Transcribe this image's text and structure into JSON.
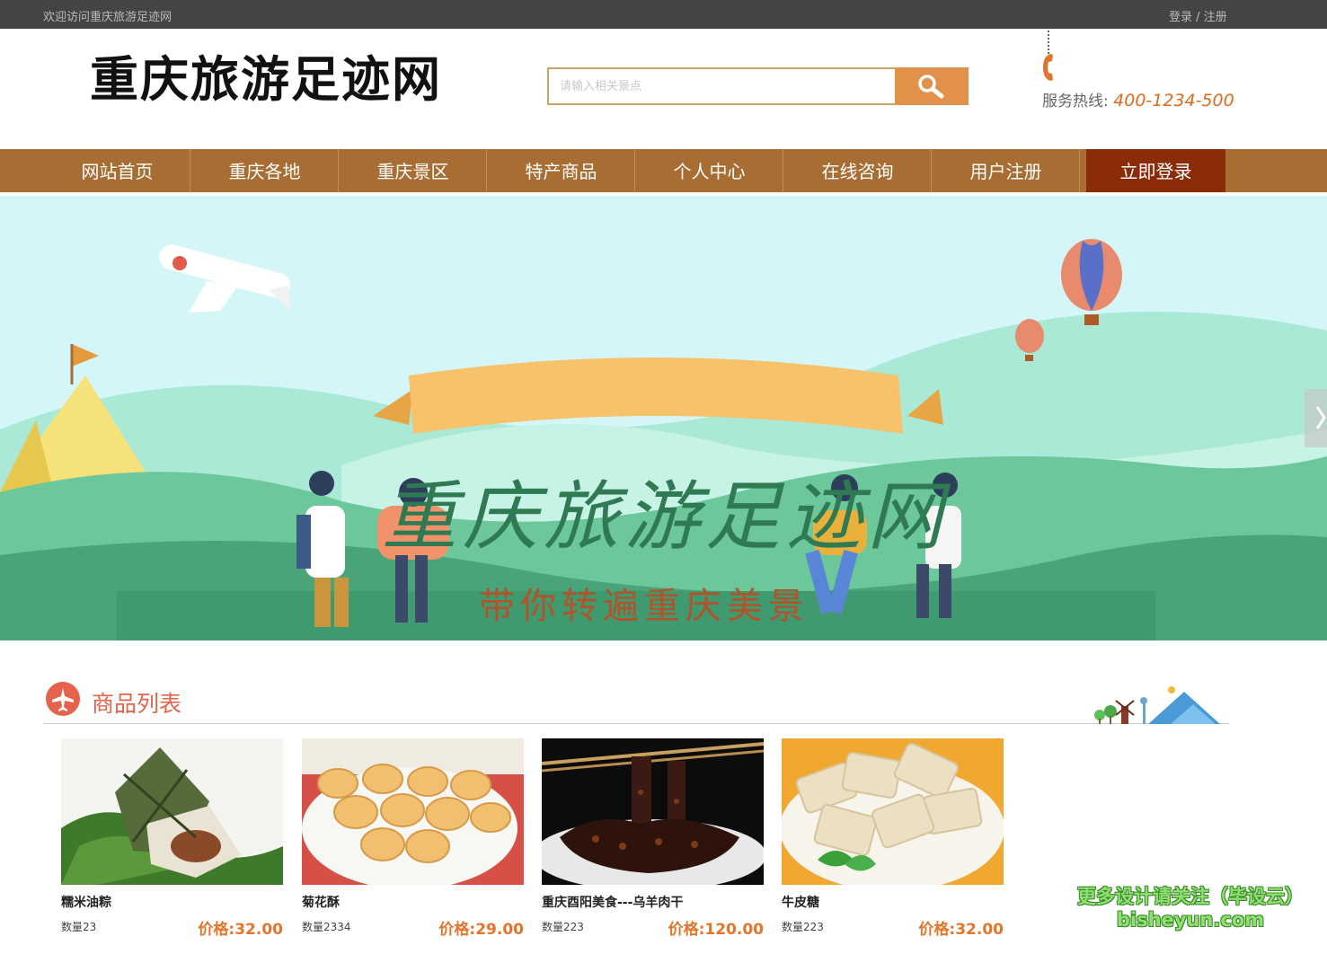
{
  "topbar": {
    "welcome": "欢迎访问重庆旅游足迹网",
    "login": "登录",
    "separator": " / ",
    "register": "注册"
  },
  "header": {
    "logo_text": "重庆旅游足迹网",
    "search_placeholder": "请输入相关景点",
    "hotline_label": "服务热线: ",
    "hotline_number": "400-1234-500"
  },
  "nav": {
    "items": [
      "网站首页",
      "重庆各地",
      "重庆景区",
      "特产商品",
      "个人中心",
      "在线咨询",
      "用户注册",
      "立即登录"
    ],
    "active_index": 7
  },
  "banner": {
    "title": "重庆旅游足迹网",
    "subtitle": "带你转遍重庆美景"
  },
  "section": {
    "title": "商品列表"
  },
  "products": [
    {
      "name": "糯米油粽",
      "qty": "数量23",
      "price": "价格:32.00",
      "image": "zongzi"
    },
    {
      "name": "菊花酥",
      "qty": "数量2334",
      "price": "价格:29.00",
      "image": "chrysanthemum-pastry"
    },
    {
      "name": "重庆酉阳美食---乌羊肉干",
      "qty": "数量223",
      "price": "价格:120.00",
      "image": "dried-mutton"
    },
    {
      "name": "牛皮糖",
      "qty": "数量223",
      "price": "价格:32.00",
      "image": "sesame-candy"
    }
  ],
  "watermark": {
    "line1": "更多设计请关注（毕设云）",
    "line2": "bisheyun.com"
  },
  "colors": {
    "topbar": "#444444",
    "nav": "#a86d33",
    "nav_active": "#8a2b0a",
    "accent": "#e1914a",
    "price": "#e8742a",
    "section_title": "#e5634a"
  }
}
